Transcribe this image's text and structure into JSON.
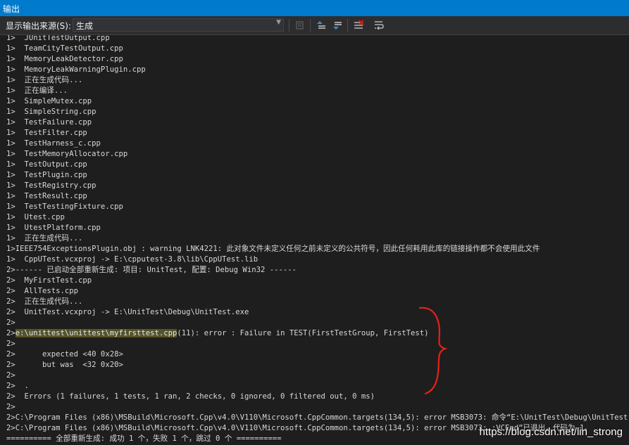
{
  "window": {
    "title": "输出"
  },
  "toolbar": {
    "source_label": "显示输出来源(S):",
    "source_value": "生成",
    "buttons": [
      {
        "name": "go-to-error-icon"
      },
      {
        "name": "previous-message-icon"
      },
      {
        "name": "next-message-icon"
      },
      {
        "name": "clear-all-icon"
      },
      {
        "name": "word-wrap-icon"
      }
    ]
  },
  "output": {
    "lines": [
      "1>  JUnitTestOutput.cpp",
      "1>  TeamCityTestOutput.cpp",
      "1>  MemoryLeakDetector.cpp",
      "1>  MemoryLeakWarningPlugin.cpp",
      "1>  正在生成代码...",
      "1>  正在编译...",
      "1>  SimpleMutex.cpp",
      "1>  SimpleString.cpp",
      "1>  TestFailure.cpp",
      "1>  TestFilter.cpp",
      "1>  TestHarness_c.cpp",
      "1>  TestMemoryAllocator.cpp",
      "1>  TestOutput.cpp",
      "1>  TestPlugin.cpp",
      "1>  TestRegistry.cpp",
      "1>  TestResult.cpp",
      "1>  TestTestingFixture.cpp",
      "1>  Utest.cpp",
      "1>  UtestPlatform.cpp",
      "1>  正在生成代码...",
      "1>IEEE754ExceptionsPlugin.obj : warning LNK4221: 此对象文件未定义任何之前未定义的公共符号，因此任何耗用此库的链接操作都不会使用此文件",
      "1>  CppUTest.vcxproj -> E:\\cpputest-3.8\\lib\\CppUTest.lib",
      "2>------ 已启动全部重新生成: 项目: UnitTest, 配置: Debug Win32 ------",
      "2>  MyFirstTest.cpp",
      "2>  AllTests.cpp",
      "2>  正在生成代码...",
      "2>  UnitTest.vcxproj -> E:\\UnitTest\\Debug\\UnitTest.exe",
      "2>",
      "2>",
      "2>      expected <40 0x28>",
      "2>      but was  <32 0x20>",
      "2>",
      "2>  .",
      "2>  Errors (1 failures, 1 tests, 1 ran, 2 checks, 0 ignored, 0 filtered out, 0 ms)",
      "2>",
      "2>C:\\Program Files (x86)\\MSBuild\\Microsoft.Cpp\\v4.0\\V110\\Microsoft.CppCommon.targets(134,5): error MSB3073: 命令“E:\\UnitTest\\Debug\\UnitTest.exe",
      "2>C:\\Program Files (x86)\\MSBuild\\Microsoft.Cpp\\v4.0\\V110\\Microsoft.CppCommon.targets(134,5): error MSB3073: :VCEnd”已退出，代码为 1。",
      "========== 全部重新生成: 成功 1 个，失败 1 个，跳过 0 个 =========="
    ],
    "error_line": {
      "prefix": "2>",
      "highlight": "e:\\unittest\\unittest\\myfirsttest.cpp",
      "rest": "(11): error : Failure in TEST(FirstTestGroup, FirstTest)"
    }
  },
  "watermark": "https://blog.csdn.net/lin_strong",
  "colors": {
    "title_bar": "#007acc",
    "toolbar": "#2d2d30",
    "output_bg": "#1e1e1e",
    "text": "#d8d8d8",
    "highlight": "#55532a",
    "annotation": "#e8201a"
  }
}
